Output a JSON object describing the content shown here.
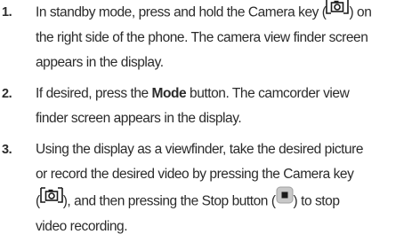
{
  "steps": [
    {
      "number": "1.",
      "line1_pre": "In standby mode, press and hold the Camera key (",
      "line1_post": ") on",
      "line2": "the right side of the phone. The camera view finder screen",
      "line3": "appears in the display.",
      "icon": "camera-key-icon"
    },
    {
      "number": "2.",
      "line1_pre": "If desired, press the ",
      "line1_bold": "Mode",
      "line1_post": " button. The camcorder view",
      "line2": "finder screen appears in the display."
    },
    {
      "number": "3.",
      "line1": "Using the display as a viewfinder, take the desired picture",
      "line2": "or record the desired video by pressing the Camera key",
      "line3_pre": "(",
      "line3_mid": "), and then pressing the Stop button (",
      "line3_post": ") to stop",
      "line4": "video recording.",
      "icons": [
        "camera-key-icon",
        "stop-button-icon"
      ]
    }
  ],
  "colors": {
    "text": "#2b2b2b",
    "icon": "#1a1a1a",
    "stop_bg": "#c8c8c8"
  }
}
